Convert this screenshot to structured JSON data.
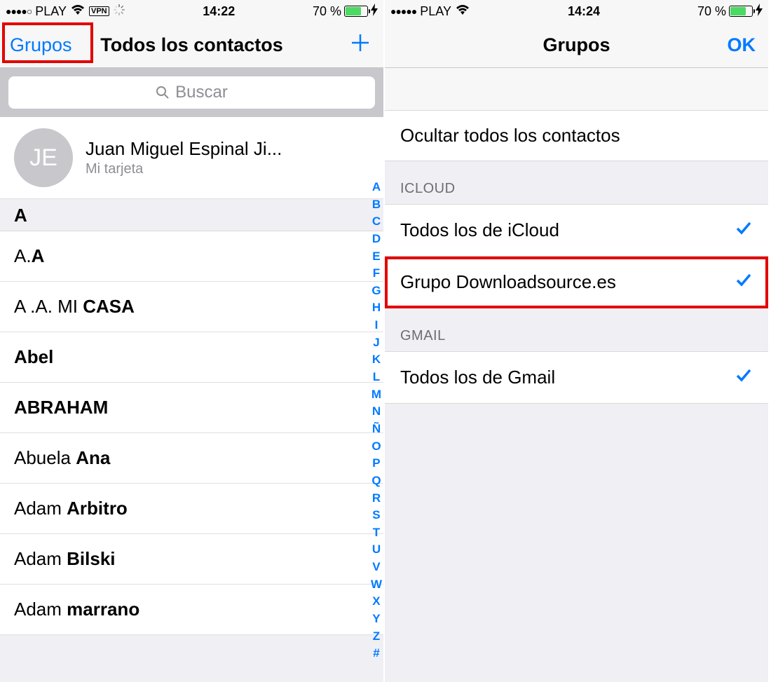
{
  "left": {
    "status": {
      "carrier": "PLAY",
      "vpn": "VPN",
      "time": "14:22",
      "battery_pct": "70 %"
    },
    "nav": {
      "groups": "Grupos",
      "title": "Todos los contactos"
    },
    "search_placeholder": "Buscar",
    "me": {
      "initials": "JE",
      "name": "Juan Miguel Espinal Ji...",
      "sub": "Mi tarjeta"
    },
    "section": "A",
    "contacts": [
      {
        "first": "A.",
        "last": "A"
      },
      {
        "first": "A .A. MI ",
        "last": "CASA"
      },
      {
        "first": "",
        "last": "Abel"
      },
      {
        "first": "",
        "last": "ABRAHAM"
      },
      {
        "first": "Abuela ",
        "last": "Ana"
      },
      {
        "first": "Adam ",
        "last": "Arbitro"
      },
      {
        "first": "Adam ",
        "last": "Bilski"
      },
      {
        "first": "Adam ",
        "last": "marrano"
      }
    ],
    "index": [
      "A",
      "B",
      "C",
      "D",
      "E",
      "F",
      "G",
      "H",
      "I",
      "J",
      "K",
      "L",
      "M",
      "N",
      "Ñ",
      "O",
      "P",
      "Q",
      "R",
      "S",
      "T",
      "U",
      "V",
      "W",
      "X",
      "Y",
      "Z",
      "#"
    ]
  },
  "right": {
    "status": {
      "carrier": "PLAY",
      "time": "14:24",
      "battery_pct": "70 %"
    },
    "nav": {
      "title": "Grupos",
      "ok": "OK"
    },
    "hide_all": "Ocultar todos los contactos",
    "sections": [
      {
        "header": "ICLOUD",
        "items": [
          {
            "label": "Todos los de iCloud",
            "checked": true,
            "hl": false
          },
          {
            "label": "Grupo Downloadsource.es",
            "checked": true,
            "hl": true
          }
        ]
      },
      {
        "header": "GMAIL",
        "items": [
          {
            "label": "Todos los de Gmail",
            "checked": true,
            "hl": false
          }
        ]
      }
    ]
  }
}
